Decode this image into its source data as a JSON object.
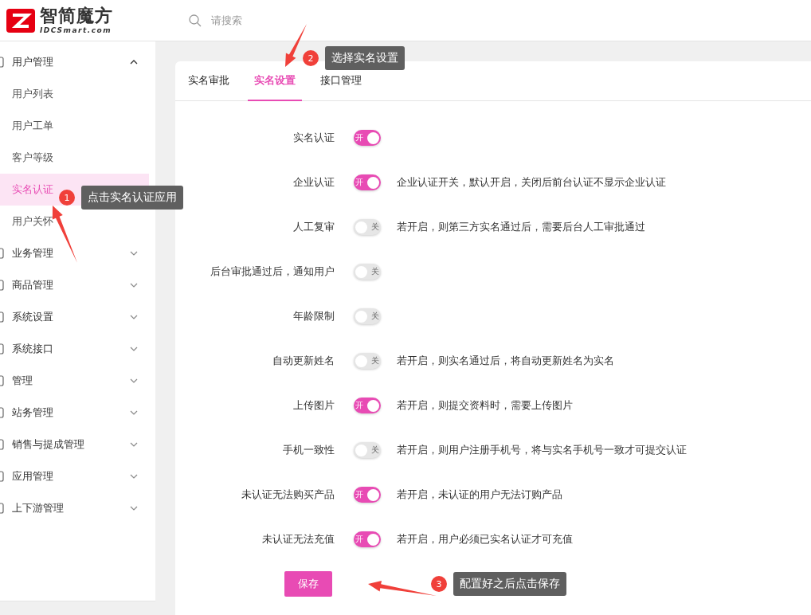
{
  "header": {
    "logo_text": "智简魔方",
    "logo_subtext": "IDCSmart.com",
    "search": {
      "placeholder": "请搜索"
    }
  },
  "sidebar": {
    "items": [
      {
        "label": "用户管理",
        "expanded": true,
        "children": [
          {
            "label": "用户列表",
            "selected": false
          },
          {
            "label": "用户工单",
            "selected": false
          },
          {
            "label": "客户等级",
            "selected": false
          },
          {
            "label": "实名认证",
            "selected": true
          },
          {
            "label": "用户关怀",
            "selected": false
          }
        ]
      },
      {
        "label": "业务管理",
        "expanded": false
      },
      {
        "label": "商品管理",
        "expanded": false
      },
      {
        "label": "系统设置",
        "expanded": false
      },
      {
        "label": "系统接口",
        "expanded": false
      },
      {
        "label": "管理",
        "expanded": false
      },
      {
        "label": "站务管理",
        "expanded": false
      },
      {
        "label": "销售与提成管理",
        "expanded": false
      },
      {
        "label": "应用管理",
        "expanded": false
      },
      {
        "label": "上下游管理",
        "expanded": false
      }
    ]
  },
  "tabs": [
    {
      "label": "实名审批",
      "selected": false
    },
    {
      "label": "实名设置",
      "selected": true
    },
    {
      "label": "接口管理",
      "selected": false
    }
  ],
  "settings": [
    {
      "label": "实名认证",
      "on": true,
      "switch_text": "开"
    },
    {
      "label": "企业认证",
      "on": true,
      "switch_text": "开",
      "description": "企业认证开关，默认开启，关闭后前台认证不显示企业认证"
    },
    {
      "label": "人工复审",
      "on": false,
      "switch_text": "关",
      "description": "若开启，则第三方实名通过后，需要后台人工审批通过"
    },
    {
      "label": "后台审批通过后，通知用户",
      "on": false,
      "switch_text": "关"
    },
    {
      "label": "年龄限制",
      "on": false,
      "switch_text": "关"
    },
    {
      "label": "自动更新姓名",
      "on": false,
      "switch_text": "关",
      "description": "若开启，则实名通过后，将自动更新姓名为实名"
    },
    {
      "label": "上传图片",
      "on": true,
      "switch_text": "开",
      "description": "若开启，则提交资料时，需要上传图片"
    },
    {
      "label": "手机一致性",
      "on": false,
      "switch_text": "关",
      "description": "若开启，则用户注册手机号，将与实名手机号一致才可提交认证"
    },
    {
      "label": "未认证无法购买产品",
      "on": true,
      "switch_text": "开",
      "description": "若开启，未认证的用户无法订购产品"
    },
    {
      "label": "未认证无法充值",
      "on": true,
      "switch_text": "开",
      "description": "若开启，用户必须已实名认证才可充值"
    }
  ],
  "save_button": "保存",
  "annotations": [
    {
      "number": "1",
      "text": "点击实名认证应用"
    },
    {
      "number": "2",
      "text": "选择实名设置"
    },
    {
      "number": "3",
      "text": "配置好之后点击保存"
    }
  ]
}
